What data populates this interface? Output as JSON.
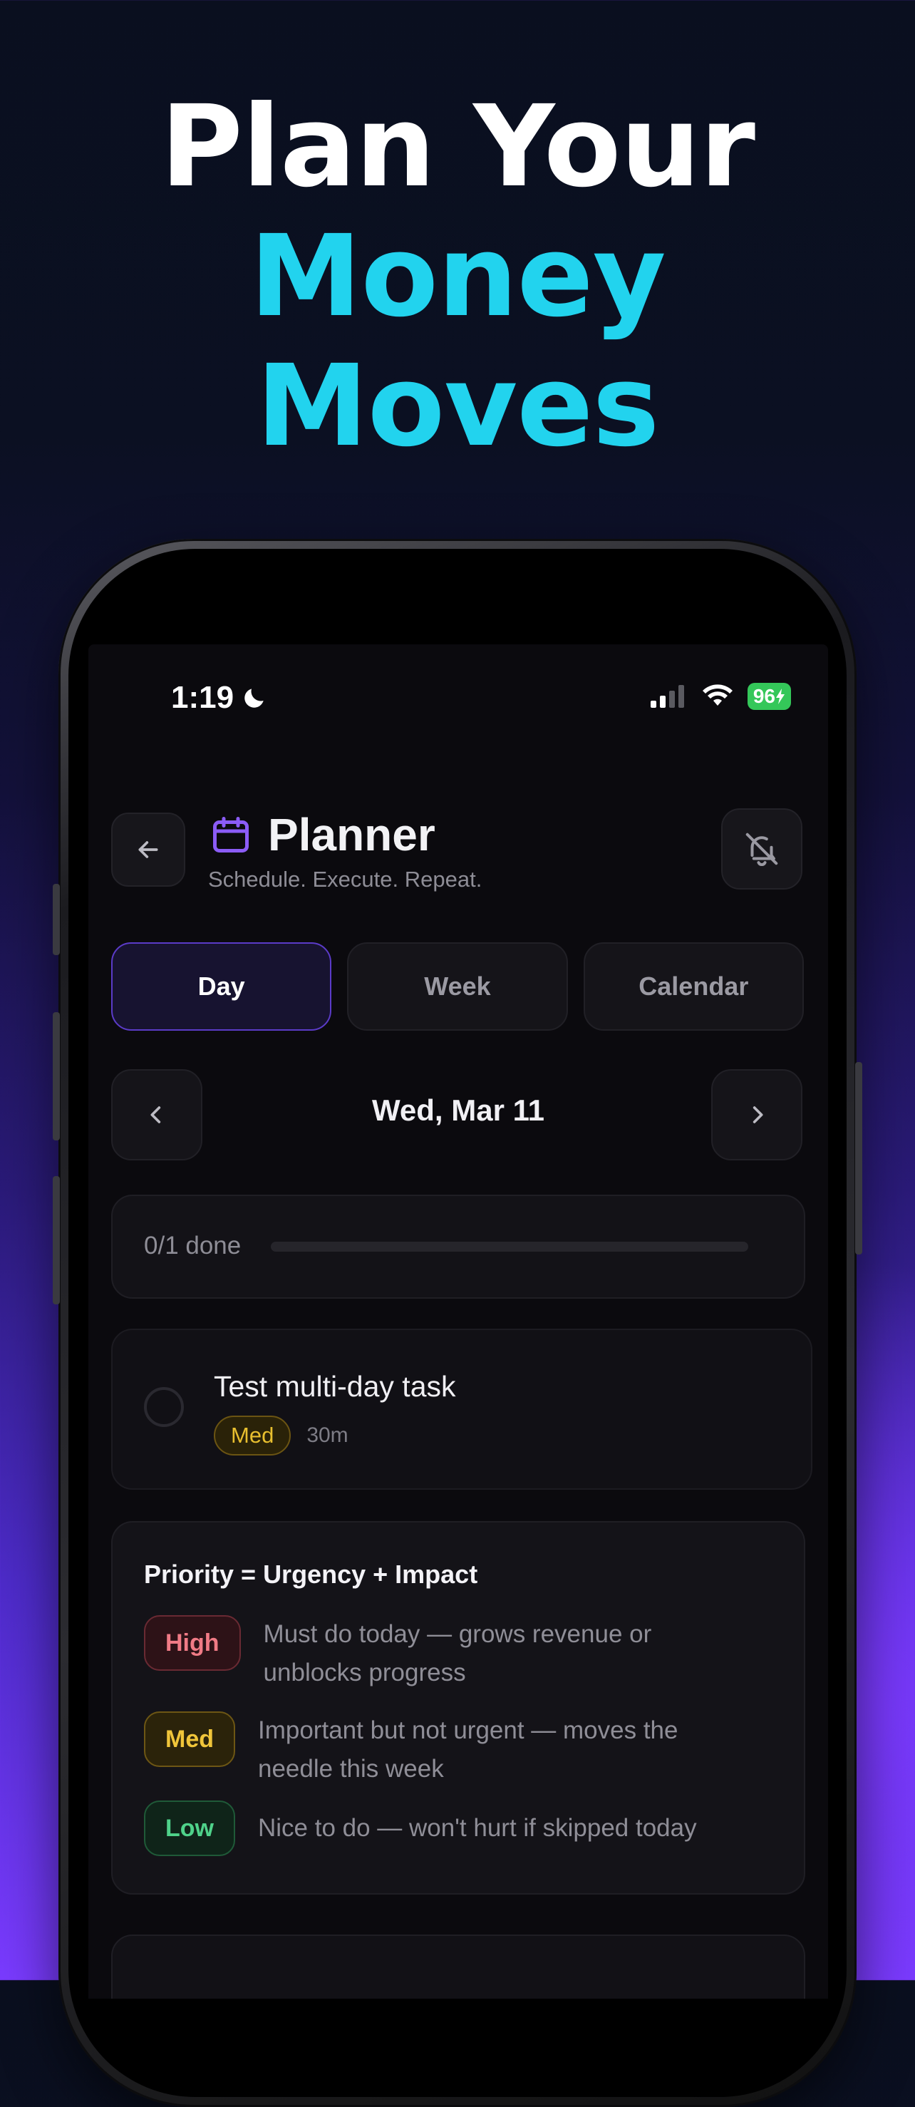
{
  "headline": {
    "line1": "Plan Your",
    "line2": "Money",
    "line3": "Moves"
  },
  "status_bar": {
    "time": "1:19",
    "battery": "96"
  },
  "header": {
    "title": "Planner",
    "subtitle": "Schedule. Execute. Repeat."
  },
  "tabs": [
    {
      "label": "Day",
      "active": true
    },
    {
      "label": "Week",
      "active": false
    },
    {
      "label": "Calendar",
      "active": false
    }
  ],
  "date_nav": {
    "date": "Wed, Mar 11"
  },
  "progress": {
    "label": "0/1 done",
    "done": 0,
    "total": 1
  },
  "task": {
    "title": "Test multi-day task",
    "priority": "Med",
    "duration": "30m"
  },
  "priority_guide": {
    "title": "Priority = Urgency + Impact",
    "rows": [
      {
        "badge": "High",
        "description": "Must do today — grows revenue or unblocks progress"
      },
      {
        "badge": "Med",
        "description": "Important but not urgent — moves the needle this week"
      },
      {
        "badge": "Low",
        "description": "Nice to do — won't hurt if skipped today"
      }
    ]
  },
  "colors": {
    "accent": "#7a3bff",
    "headline_cyan": "#22d3ee",
    "high": "#f07b86",
    "med": "#f0c53a",
    "low": "#4fd28a"
  }
}
